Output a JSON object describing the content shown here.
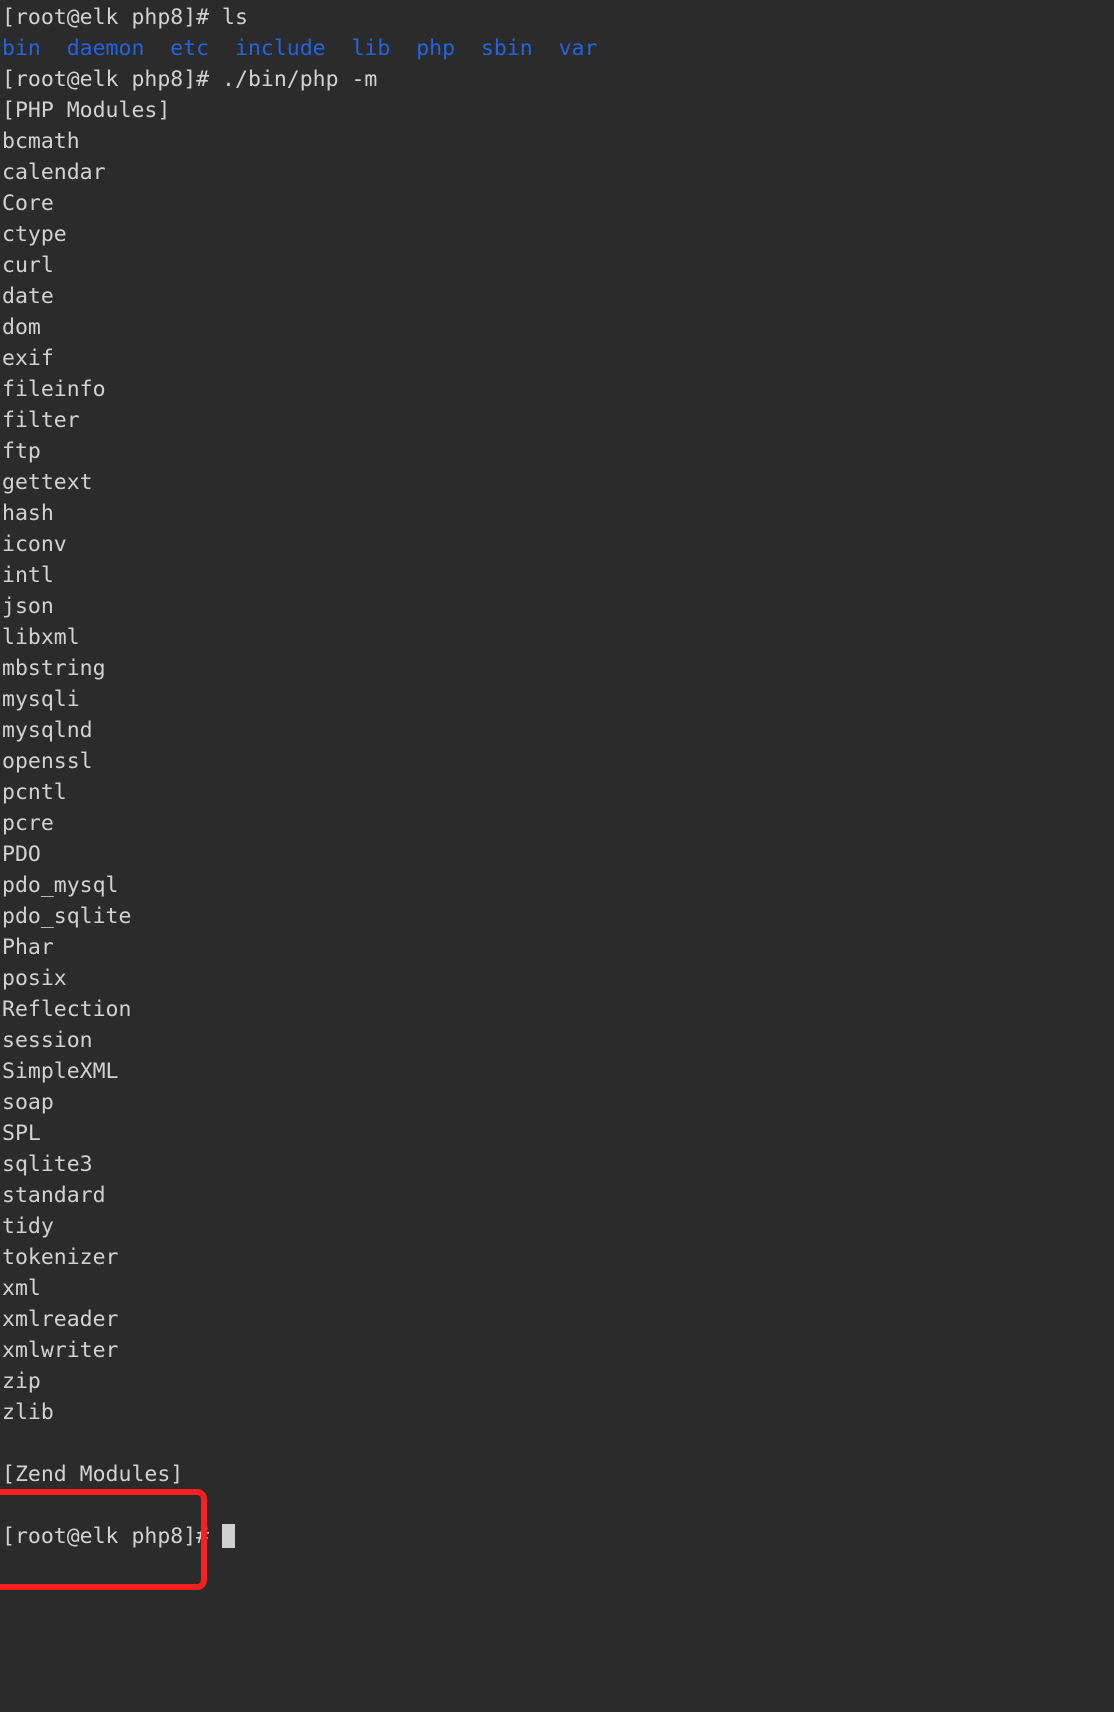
{
  "terminal": {
    "background_color": "#2b2b2b",
    "foreground_color": "#d2d2d2",
    "dir_color": "#2463e0",
    "annotation_color": "#fa2020",
    "prompt": "[root@elk php8]# ",
    "commands": {
      "ls": "ls",
      "php_modules": "./bin/php -m"
    },
    "lines": {
      "prompt_ls": "[root@elk php8]# ls",
      "dir_listing": "bin  daemon  etc  include  lib  php  sbin  var",
      "prompt_php_m": "[root@elk php8]# ./bin/php -m",
      "php_modules_header": "[PHP Modules]",
      "zend_modules_header": "[Zend Modules]",
      "final_prompt": "[root@elk php8]# "
    },
    "directories": [
      "bin",
      "daemon",
      "etc",
      "include",
      "lib",
      "php",
      "sbin",
      "var"
    ],
    "php_modules": [
      "bcmath",
      "calendar",
      "Core",
      "ctype",
      "curl",
      "date",
      "dom",
      "exif",
      "fileinfo",
      "filter",
      "ftp",
      "gettext",
      "hash",
      "iconv",
      "intl",
      "json",
      "libxml",
      "mbstring",
      "mysqli",
      "mysqlnd",
      "openssl",
      "pcntl",
      "pcre",
      "PDO",
      "pdo_mysql",
      "pdo_sqlite",
      "Phar",
      "posix",
      "Reflection",
      "session",
      "SimpleXML",
      "soap",
      "SPL",
      "sqlite3",
      "standard",
      "tidy",
      "tokenizer",
      "xml",
      "xmlreader",
      "xmlwriter",
      "zip",
      "zlib"
    ],
    "zend_modules": [],
    "highlighted_modules": [
      "zip",
      "zlib"
    ]
  }
}
